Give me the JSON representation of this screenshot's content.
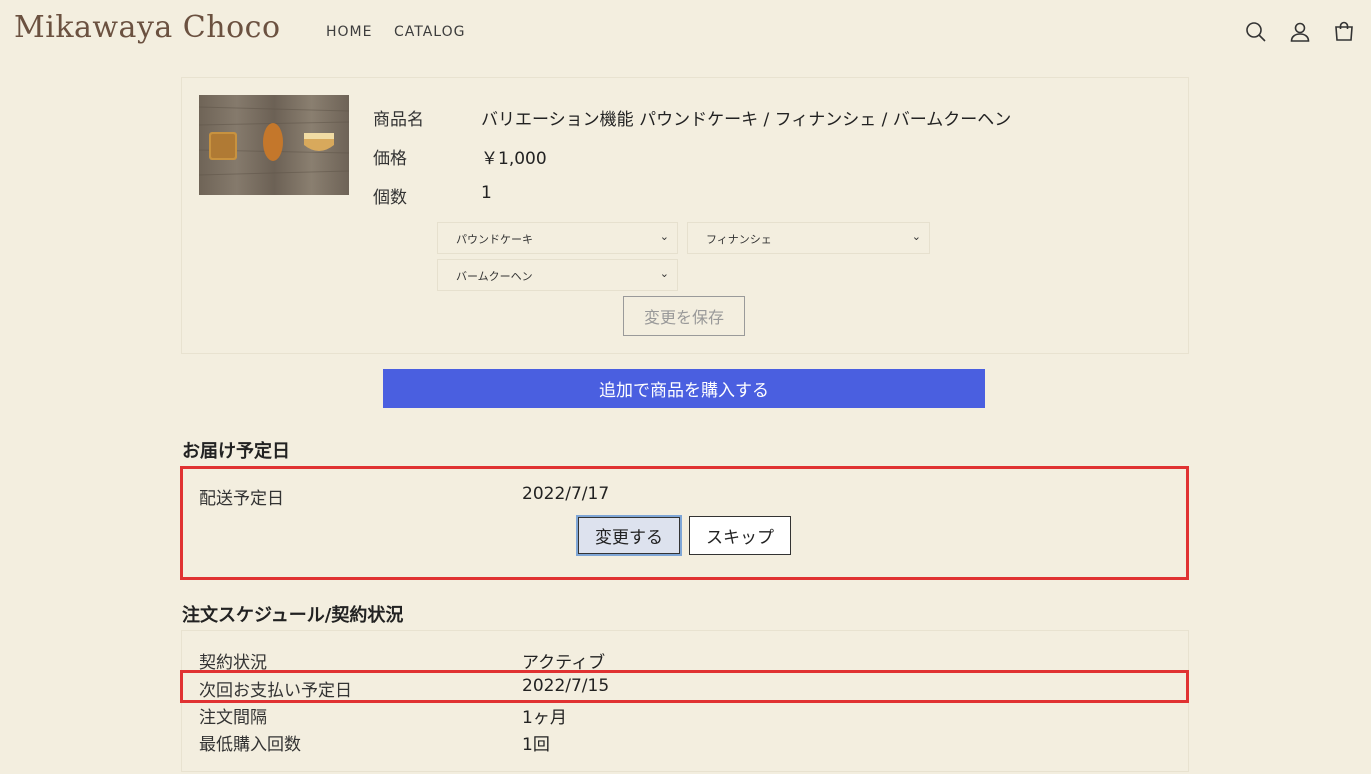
{
  "header": {
    "logo": "Mikawaya Choco",
    "nav": [
      "HOME",
      "CATALOG"
    ],
    "icons": [
      "search-icon",
      "account-icon",
      "cart-icon"
    ]
  },
  "product": {
    "name_label": "商品名",
    "name_value": "バリエーション機能 パウンドケーキ / フィナンシェ / バームクーヘン",
    "price_label": "価格",
    "price_value": "￥1,000",
    "qty_label": "個数",
    "qty_value": "1",
    "selects": [
      "パウンドケーキ",
      "フィナンシェ",
      "バームクーヘン"
    ],
    "save_button": "変更を保存"
  },
  "buy_button": "追加で商品を購入する",
  "delivery": {
    "title": "お届け予定日",
    "date_label": "配送予定日",
    "date_value": "2022/7/17",
    "change_button": "変更する",
    "skip_button": "スキップ"
  },
  "schedule": {
    "title": "注文スケジュール/契約状況",
    "rows": [
      {
        "label": "契約状況",
        "value": "アクティブ"
      },
      {
        "label": "次回お支払い予定日",
        "value": "2022/7/15"
      },
      {
        "label": "注文間隔",
        "value": "1ヶ月"
      },
      {
        "label": "最低購入回数",
        "value": "1回"
      }
    ]
  },
  "colors": {
    "background": "#f3eedf",
    "buy_button": "#4a5fe0",
    "highlight_box": "#e03232",
    "logo": "#6b5140"
  }
}
